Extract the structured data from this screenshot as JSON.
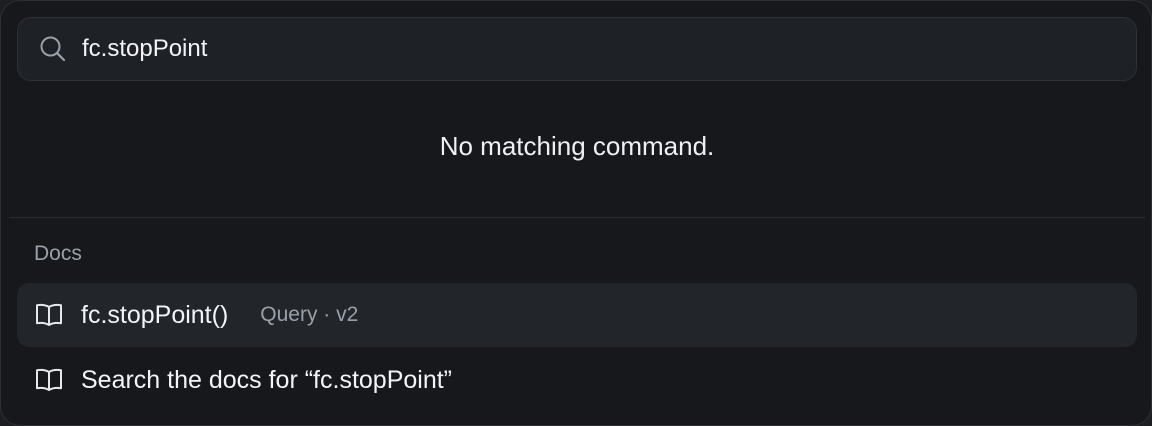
{
  "search": {
    "value": "fc.stopPoint",
    "icon": "search-icon"
  },
  "results": {
    "empty_message": "No matching command."
  },
  "docs": {
    "group_label": "Docs",
    "items": [
      {
        "label": "fc.stopPoint()",
        "meta": "Query · v2",
        "icon": "book-icon",
        "selected": true
      },
      {
        "label": "Search the docs for “fc.stopPoint”",
        "icon": "book-icon",
        "selected": false
      }
    ]
  },
  "colors": {
    "background": "#16181c",
    "text": "#f2f4f7",
    "muted_text": "#9aa0a8",
    "selected_row": "#22252a"
  }
}
